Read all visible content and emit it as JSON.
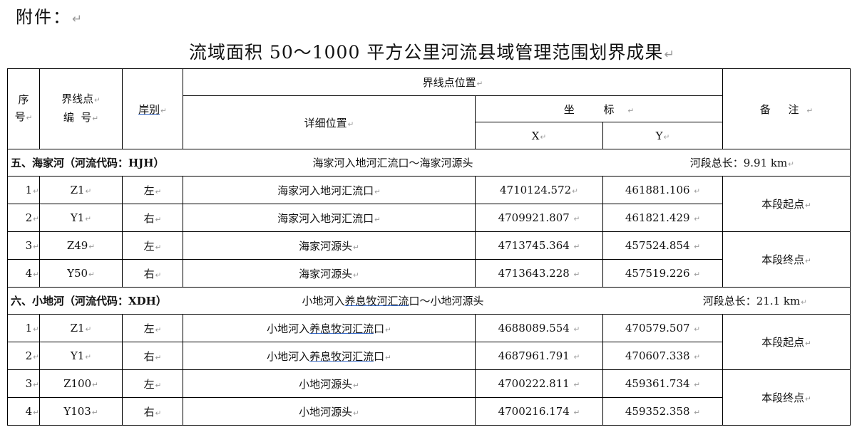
{
  "attachment_label": "附件：",
  "title": "流域面积 50～1000 平方公里河流县域管理范围划界成果",
  "header": {
    "seq_line1": "序",
    "seq_line2": "号",
    "point_line1": "界线点",
    "point_line2": "编  号",
    "bank": "岸别",
    "position_group": "界线点位置",
    "detail": "详细位置",
    "coord": "坐 标",
    "x": "X",
    "y": "Y",
    "remark": "备 注"
  },
  "sections": [
    {
      "name": "五、海家河（河流代码：HJH）",
      "desc": "海家河入地河汇流口～海家河源头",
      "length": "河段总长：9.91 km",
      "rows": [
        {
          "seq": "1",
          "point": "Z1",
          "bank": "左",
          "detail": "海家河入地河汇流口",
          "x": "4710124.572",
          "y": "461881.106"
        },
        {
          "seq": "2",
          "point": "Y1",
          "bank": "右",
          "detail": "海家河入地河汇流口",
          "x": "4709921.807",
          "y": "461821.429"
        },
        {
          "seq": "3",
          "point": "Z49",
          "bank": "左",
          "detail": "海家河源头",
          "x": "4713745.364",
          "y": "457524.854"
        },
        {
          "seq": "4",
          "point": "Y50",
          "bank": "右",
          "detail": "海家河源头",
          "x": "4713643.228",
          "y": "457519.226"
        }
      ],
      "remarks": [
        "本段起点",
        "本段终点"
      ]
    },
    {
      "name": "六、小地河（河流代码：XDH）",
      "desc_prefix": "小地河入",
      "desc_underlined": "养息牧河汇流",
      "desc_suffix": "口～小地河源头",
      "length": "河段总长：21.1 km",
      "rows": [
        {
          "seq": "1",
          "point": "Z1",
          "bank": "左",
          "detail_prefix": "小地河入",
          "detail_underlined": "养息牧河汇流",
          "detail_suffix": "口",
          "x": "4688089.554",
          "y": "470579.507"
        },
        {
          "seq": "2",
          "point": "Y1",
          "bank": "右",
          "detail_prefix": "小地河入",
          "detail_underlined": "养息牧河汇流",
          "detail_suffix": "口",
          "x": "4687961.791",
          "y": "470607.338"
        },
        {
          "seq": "3",
          "point": "Z100",
          "bank": "左",
          "detail": "小地河源头",
          "x": "4700222.811",
          "y": "459361.734"
        },
        {
          "seq": "4",
          "point": "Y103",
          "bank": "右",
          "detail": "小地河源头",
          "x": "4700216.174",
          "y": "459352.358"
        }
      ],
      "remarks": [
        "本段起点",
        "本段终点"
      ]
    }
  ]
}
